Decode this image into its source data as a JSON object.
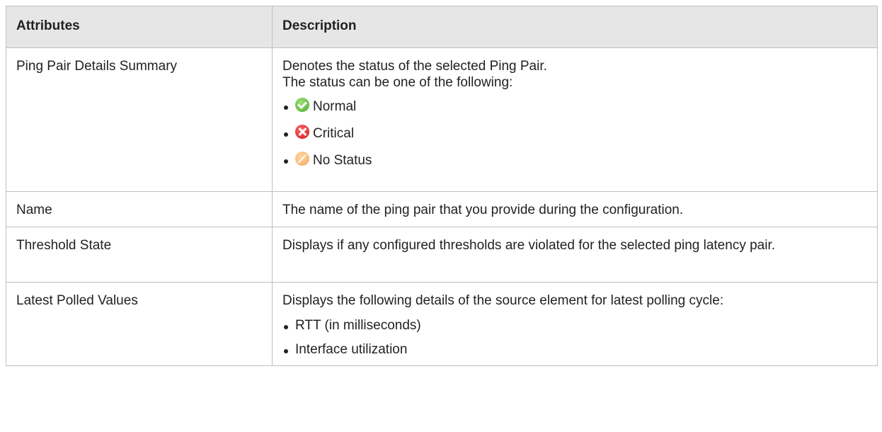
{
  "table": {
    "headers": [
      "Attributes",
      "Description"
    ],
    "row1": {
      "attribute": "Ping Pair Details Summary",
      "desc_line1": "Denotes the status of the selected Ping Pair.",
      "desc_line2": "The status can be one of the following:",
      "statuses": [
        {
          "label": "Normal",
          "icon": "normal-status-icon",
          "color": "#4caa2c"
        },
        {
          "label": "Critical",
          "icon": "critical-status-icon",
          "color": "#d0161d"
        },
        {
          "label": "No Status",
          "icon": "no-status-icon",
          "color": "#f2a85a"
        }
      ]
    },
    "row2": {
      "attribute": "Name",
      "description": "The name of the ping pair that you provide during the configuration."
    },
    "row3": {
      "attribute": "Threshold State",
      "description": "Displays if any configured thresholds are violated for the selected ping latency pair."
    },
    "row4": {
      "attribute": "Latest Polled Values",
      "description": "Displays the following details of the source element for latest polling cycle:",
      "items": [
        "RTT (in milliseconds)",
        "Interface utilization"
      ]
    }
  }
}
